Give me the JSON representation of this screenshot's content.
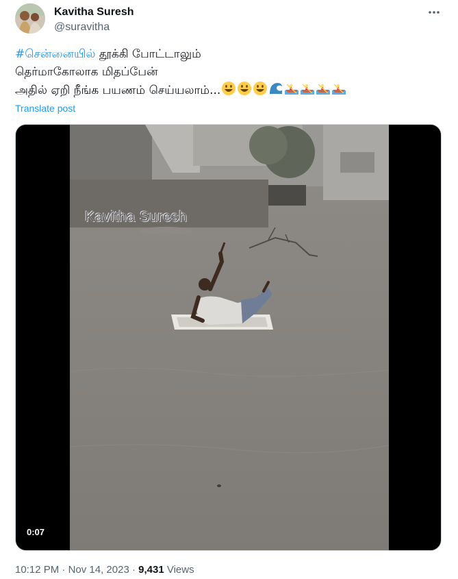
{
  "author": {
    "display_name": "Kavitha Suresh",
    "handle": "@suravitha",
    "avatar_icon": "profile-photo"
  },
  "tweet": {
    "hashtag": "#சென்னையில்",
    "line1_rest": " தூக்கி போட்டாலும்",
    "line2": "தெர்மாகோலாக மிதப்பேன்",
    "line3": "அதில் ஏறி நீங்க பயணம் செய்யலாம்...",
    "emojis": [
      "smiley",
      "smiley",
      "smiley",
      "water-wave",
      "rowboat",
      "rowboat",
      "rowboat",
      "rowboat"
    ]
  },
  "translate_label": "Translate post",
  "media": {
    "watermark": "Kavitha Suresh",
    "duration": "0:07"
  },
  "meta": {
    "time": "10:12 PM",
    "separator": " · ",
    "date": "Nov 14, 2023",
    "views_count": "9,431",
    "views_label": "Views"
  },
  "colors": {
    "accent": "#1d9bf0",
    "text": "#0f1419",
    "secondary": "#536471"
  }
}
